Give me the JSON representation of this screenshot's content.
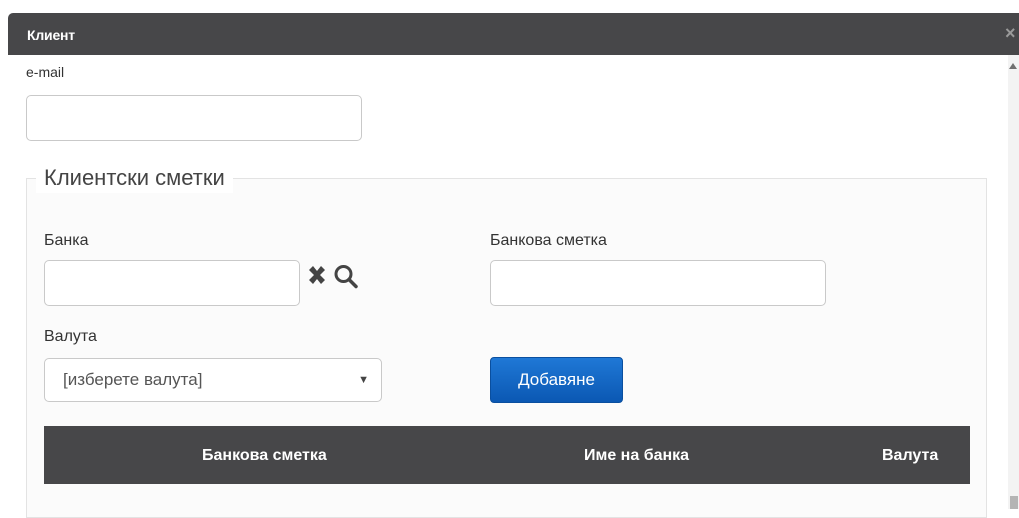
{
  "dialog": {
    "title": "Клиент",
    "close_glyph": "×"
  },
  "email": {
    "label": "e-mail",
    "value": ""
  },
  "accounts_section": {
    "legend": "Клиентски сметки",
    "bank": {
      "label": "Банка",
      "value": "",
      "clear_icon": "close-icon",
      "search_icon": "search-icon"
    },
    "bank_account": {
      "label": "Банкова сметка",
      "value": ""
    },
    "currency": {
      "label": "Валута",
      "selected": "[изберете валута]"
    },
    "add_button": "Добавяне",
    "table": {
      "columns": [
        "Банкова сметка",
        "Име на банка",
        "Валута"
      ],
      "rows": []
    }
  },
  "colors": {
    "header_bg": "#474749",
    "button_blue": "#1467c7"
  }
}
